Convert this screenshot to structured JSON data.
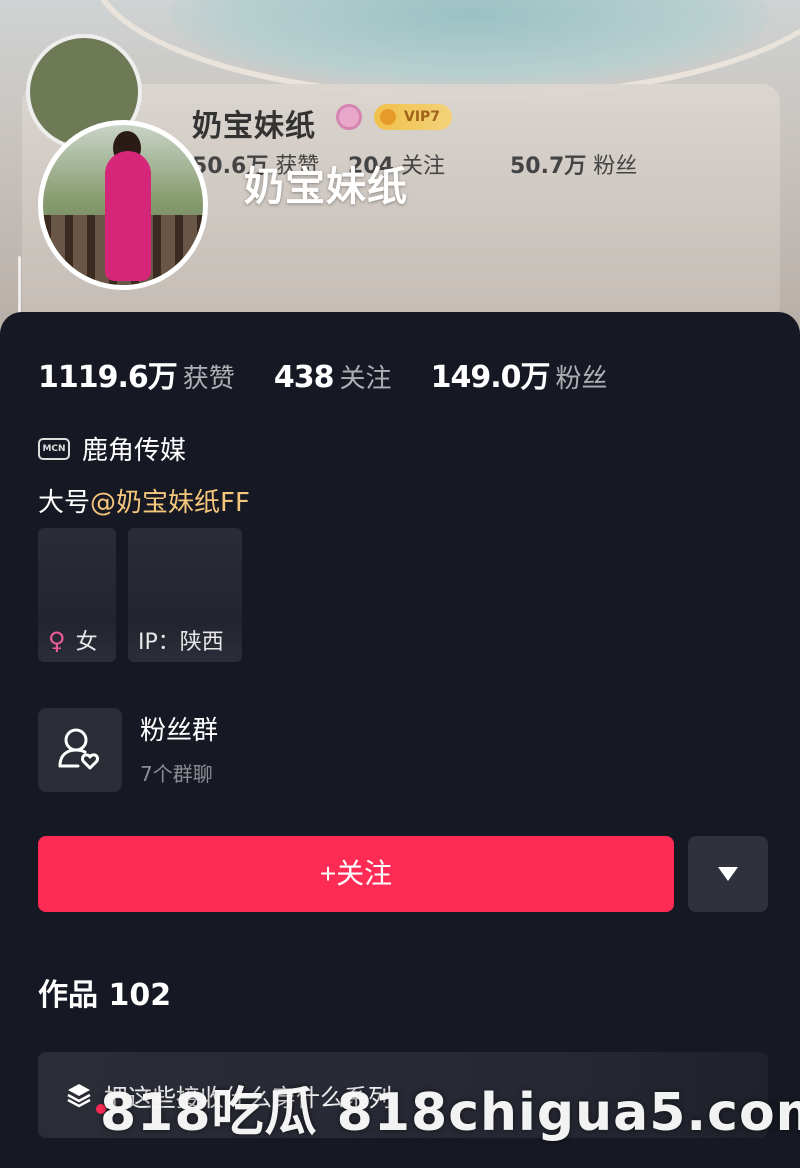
{
  "profile": {
    "name": "奶宝妹纸",
    "vip_badge": "VIP7",
    "ghost_stats": [
      {
        "num": "50.6万",
        "lbl": "获赞"
      },
      {
        "num": "204",
        "lbl": "关注"
      },
      {
        "num": "50.7万",
        "lbl": "粉丝"
      }
    ]
  },
  "stats": [
    {
      "num": "1119.6万",
      "label": "获赞"
    },
    {
      "num": "438",
      "label": "关注"
    },
    {
      "num": "149.0万",
      "label": "粉丝"
    }
  ],
  "mcn": {
    "icon_text": "MCN",
    "name": "鹿角传媒"
  },
  "bio": {
    "prefix": "大号",
    "mention": "@奶宝妹纸FF"
  },
  "tags": {
    "gender": "女",
    "ip_label": "IP：",
    "ip_value": "陕西"
  },
  "fan_group": {
    "title": "粉丝群",
    "subtitle": "7个群聊"
  },
  "actions": {
    "follow_label": "+关注"
  },
  "works": {
    "label": "作品",
    "count": "102"
  },
  "collection": {
    "title": "把这些接收什么穿什么系列"
  },
  "watermark": {
    "text": "818吃瓜 818chigua5.com"
  },
  "colors": {
    "accent": "#fe2c55",
    "background": "#161823",
    "mention": "#f4c77c"
  }
}
